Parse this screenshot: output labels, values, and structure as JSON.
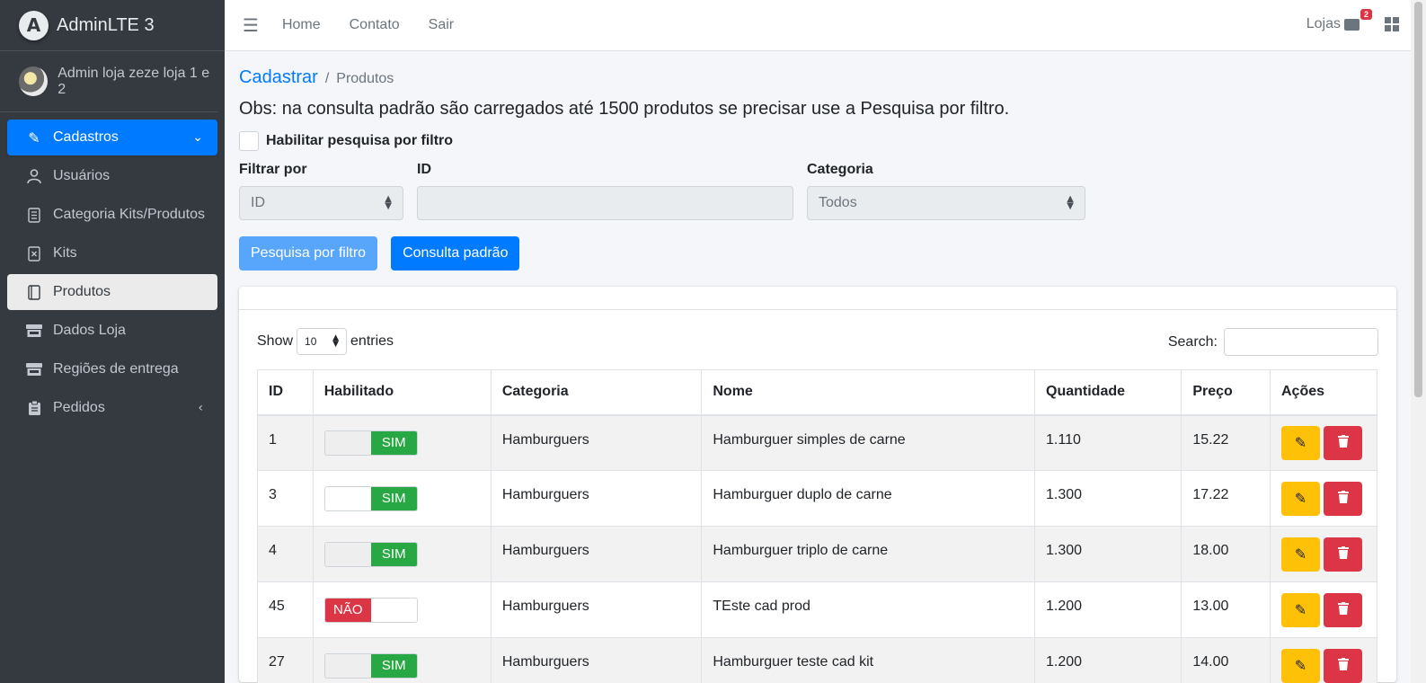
{
  "brand": {
    "name": "AdminLTE 3",
    "logo_letter": "A"
  },
  "user": {
    "name": "Admin loja zeze loja 1 e 2"
  },
  "sidebar": {
    "items": [
      {
        "label": "Cadastros",
        "icon": "pencil-icon"
      },
      {
        "label": "Usuários",
        "icon": "user-icon"
      },
      {
        "label": "Categoria Kits/Produtos",
        "icon": "list-icon"
      },
      {
        "label": "Kits",
        "icon": "box-x-icon"
      },
      {
        "label": "Produtos",
        "icon": "book-icon"
      },
      {
        "label": "Dados Loja",
        "icon": "store-icon"
      },
      {
        "label": "Regiões de entrega",
        "icon": "store-icon"
      },
      {
        "label": "Pedidos",
        "icon": "clipboard-icon"
      }
    ]
  },
  "topbar": {
    "links": [
      "Home",
      "Contato",
      "Sair"
    ],
    "lojas_label": "Lojas",
    "lojas_badge": "2"
  },
  "breadcrumb": {
    "parent": "Cadastrar",
    "current": "Produtos"
  },
  "notice": "Obs: na consulta padrão são carregados até 1500 produtos se precisar use a Pesquisa por filtro.",
  "filter": {
    "enable_label": "Habilitar pesquisa por filtro",
    "filtrar_por_label": "Filtrar por",
    "filtrar_por_value": "ID",
    "id_label": "ID",
    "categoria_label": "Categoria",
    "categoria_value": "Todos",
    "btn_filtro": "Pesquisa por filtro",
    "btn_padrao": "Consulta padrão"
  },
  "datatable": {
    "show_label": "Show",
    "length_value": "10",
    "entries_label": "entries",
    "search_label": "Search:",
    "columns": [
      "ID",
      "Habilitado",
      "Categoria",
      "Nome",
      "Quantidade",
      "Preço",
      "Ações"
    ],
    "rows": [
      {
        "id": "1",
        "enabled": true,
        "label": "SIM",
        "categoria": "Hamburguers",
        "nome": "Hamburguer simples de carne",
        "quantidade": "1.110",
        "preco": "15.22"
      },
      {
        "id": "3",
        "enabled": true,
        "label": "SIM",
        "categoria": "Hamburguers",
        "nome": "Hamburguer duplo de carne",
        "quantidade": "1.300",
        "preco": "17.22"
      },
      {
        "id": "4",
        "enabled": true,
        "label": "SIM",
        "categoria": "Hamburguers",
        "nome": "Hamburguer triplo de carne",
        "quantidade": "1.300",
        "preco": "18.00"
      },
      {
        "id": "45",
        "enabled": false,
        "label": "NÃO",
        "categoria": "Hamburguers",
        "nome": "TEste cad prod",
        "quantidade": "1.200",
        "preco": "13.00"
      },
      {
        "id": "27",
        "enabled": true,
        "label": "SIM",
        "categoria": "Hamburguers",
        "nome": "Hamburguer teste cad kit",
        "quantidade": "1.200",
        "preco": "14.00"
      }
    ]
  },
  "colors": {
    "primary": "#007bff",
    "success": "#28a745",
    "danger": "#dc3545",
    "warning": "#ffc107",
    "sidebar": "#343a40"
  }
}
